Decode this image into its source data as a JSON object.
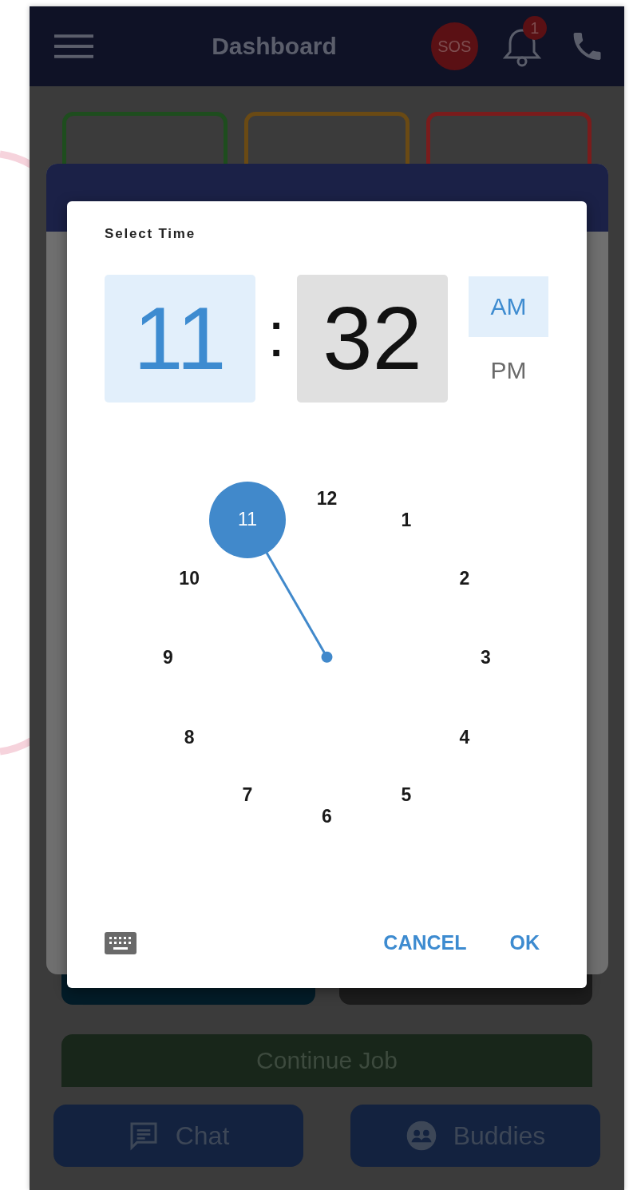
{
  "app_bar": {
    "title": "Dashboard",
    "sos": "SOS",
    "notification_count": "1"
  },
  "counters": [
    {
      "color": "#1e4d1e"
    },
    {
      "color": "#6a4a14"
    },
    {
      "color": "#7a1c1c"
    }
  ],
  "time_picker": {
    "title": "Select Time",
    "separator": ":",
    "fields": [
      {
        "value": "11",
        "selected": true
      },
      {
        "value": "32",
        "selected": false
      }
    ],
    "periods": [
      {
        "label": "AM",
        "selected": true
      },
      {
        "label": "PM",
        "selected": false
      }
    ],
    "dial": [
      {
        "label": "12",
        "selected": false
      },
      {
        "label": "1",
        "selected": false
      },
      {
        "label": "2",
        "selected": false
      },
      {
        "label": "3",
        "selected": false
      },
      {
        "label": "4",
        "selected": false
      },
      {
        "label": "5",
        "selected": false
      },
      {
        "label": "6",
        "selected": false
      },
      {
        "label": "7",
        "selected": false
      },
      {
        "label": "8",
        "selected": false
      },
      {
        "label": "9",
        "selected": false
      },
      {
        "label": "10",
        "selected": false
      },
      {
        "label": "11",
        "selected": true
      }
    ],
    "cancel": "CANCEL",
    "ok": "OK"
  },
  "continue_button": "Continue Job",
  "bottom_buttons": [
    {
      "kind": "chat",
      "label": "Chat"
    },
    {
      "kind": "buddies",
      "label": "Buddies"
    }
  ]
}
